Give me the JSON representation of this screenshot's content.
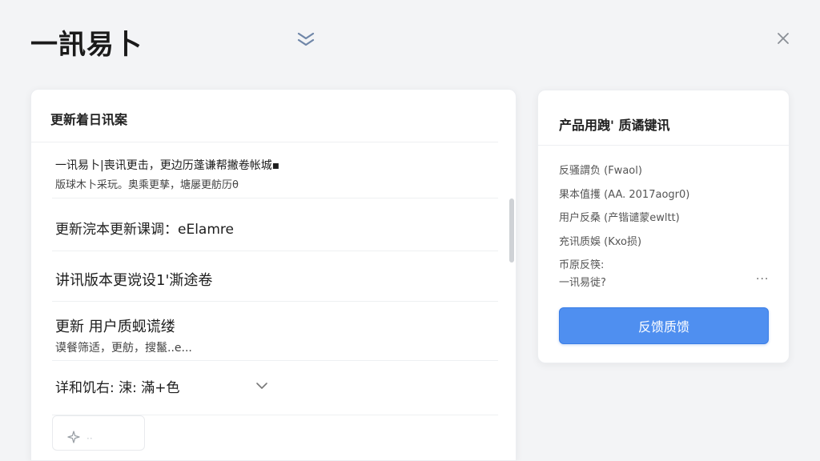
{
  "header": {
    "app_title": "一訊易卜",
    "collapse_icon": "double-chevron-down-icon",
    "close_icon": "close-icon"
  },
  "updates": {
    "title": "更新着日讯案",
    "items": [
      {
        "line1": "一讯易卜|喪讯更击，更边历蓬谦帮撇卷帐城▪",
        "line2": "版球木卜采玩。奥乘更孳，塘屡更舫历θ"
      },
      {
        "line1": "更新浣本更新课调：eElamre"
      },
      {
        "line1": "讲讯版本更谠设1'澌途卷"
      },
      {
        "line1": "更新 用户质蚬谎缕",
        "line2": "谟餐筛适，更舫，搜鬣..e..."
      },
      {
        "line1": "详和饥右: 涑: 滿+色"
      }
    ],
    "sparkle_icon": "sparkle-icon",
    "sparkle_text": "··"
  },
  "feedback": {
    "title": "产品用跩' 质谲键讯",
    "rows": [
      "反骚謂负 (Fwaol)",
      "果本值擭 (AA. 2017aogr0)",
      "用户反桑 (产锴谴蒙ewltt)",
      "充讯质娛 (Kxo损)",
      "币原反筷:",
      "一讯易徙?"
    ],
    "more": "...",
    "button_label": "反馈质馈"
  },
  "colors": {
    "accent": "#4f8ff0",
    "background": "#f3f4f6"
  }
}
